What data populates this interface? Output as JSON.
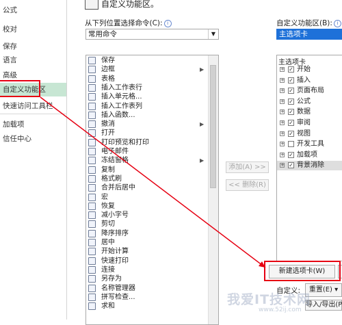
{
  "nav": {
    "items": [
      "公式",
      "校对",
      "保存",
      "语言",
      "高级",
      "自定义功能区",
      "快速访问工具栏",
      "加载项",
      "信任中心"
    ],
    "active_index": 5
  },
  "header": {
    "title": "自定义功能区。"
  },
  "left_panel": {
    "label": "从下列位置选择命令(C):",
    "dropdown_value": "常用命令",
    "commands": [
      {
        "label": "保存",
        "icon": "save-icon",
        "submenu": false
      },
      {
        "label": "边框",
        "icon": "border-icon",
        "submenu": true
      },
      {
        "label": "表格",
        "icon": "table-icon",
        "submenu": false
      },
      {
        "label": "插入工作表行",
        "icon": "insert-row-icon",
        "submenu": false
      },
      {
        "label": "插入单元格...",
        "icon": "insert-cell-icon",
        "submenu": false
      },
      {
        "label": "插入工作表列",
        "icon": "insert-column-icon",
        "submenu": false
      },
      {
        "label": "插入函数...",
        "icon": "function-icon",
        "submenu": false
      },
      {
        "label": "撤消",
        "icon": "undo-icon",
        "submenu": true
      },
      {
        "label": "打开",
        "icon": "open-icon",
        "submenu": false
      },
      {
        "label": "打印预览和打印",
        "icon": "print-preview-icon",
        "submenu": false
      },
      {
        "label": "电子邮件",
        "icon": "email-icon",
        "submenu": false
      },
      {
        "label": "冻结窗格",
        "icon": "freeze-panes-icon",
        "submenu": true
      },
      {
        "label": "复制",
        "icon": "copy-icon",
        "submenu": false
      },
      {
        "label": "格式刷",
        "icon": "format-painter-icon",
        "submenu": false
      },
      {
        "label": "合并后居中",
        "icon": "merge-center-icon",
        "submenu": false
      },
      {
        "label": "宏",
        "icon": "macro-icon",
        "submenu": false
      },
      {
        "label": "恢复",
        "icon": "redo-icon",
        "submenu": false
      },
      {
        "label": "减小字号",
        "icon": "decrease-font-icon",
        "submenu": false
      },
      {
        "label": "剪切",
        "icon": "cut-icon",
        "submenu": false
      },
      {
        "label": "降序排序",
        "icon": "sort-desc-icon",
        "submenu": false
      },
      {
        "label": "居中",
        "icon": "center-icon",
        "submenu": false
      },
      {
        "label": "开始计算",
        "icon": "calculate-icon",
        "submenu": false
      },
      {
        "label": "快速打印",
        "icon": "quick-print-icon",
        "submenu": false
      },
      {
        "label": "连接",
        "icon": "connections-icon",
        "submenu": false
      },
      {
        "label": "另存为",
        "icon": "save-as-icon",
        "submenu": false
      },
      {
        "label": "名称管理器",
        "icon": "name-manager-icon",
        "submenu": false
      },
      {
        "label": "拼写检查...",
        "icon": "spelling-icon",
        "submenu": false
      },
      {
        "label": "求和",
        "icon": "sum-icon",
        "submenu": false
      }
    ]
  },
  "middle": {
    "add_label": "添加(A) >>",
    "remove_label": "<< 删除(R)"
  },
  "right_panel": {
    "label": "自定义功能区(B):",
    "dropdown_value": "主选项卡",
    "tree_header": "主选项卡",
    "tabs": [
      {
        "label": "开始",
        "checked": true
      },
      {
        "label": "插入",
        "checked": true
      },
      {
        "label": "页面布局",
        "checked": true
      },
      {
        "label": "公式",
        "checked": true
      },
      {
        "label": "数据",
        "checked": true
      },
      {
        "label": "审阅",
        "checked": true
      },
      {
        "label": "视图",
        "checked": true
      },
      {
        "label": "开发工具",
        "checked": false
      },
      {
        "label": "加载项",
        "checked": true
      },
      {
        "label": "背景消除",
        "checked": true
      }
    ],
    "selected_index": 9,
    "new_tab_label": "新建选项卡(W)",
    "custom_label": "自定义:",
    "reset_label": "重置(E)",
    "import_export_label": "导入/导出(P)"
  },
  "watermark": {
    "text": "我爱IT技术网",
    "url": "www.52ij.com"
  },
  "colors": {
    "accent": "#1e71d9",
    "annotation": "#e60012",
    "nav_active": "#c7e6d3"
  }
}
